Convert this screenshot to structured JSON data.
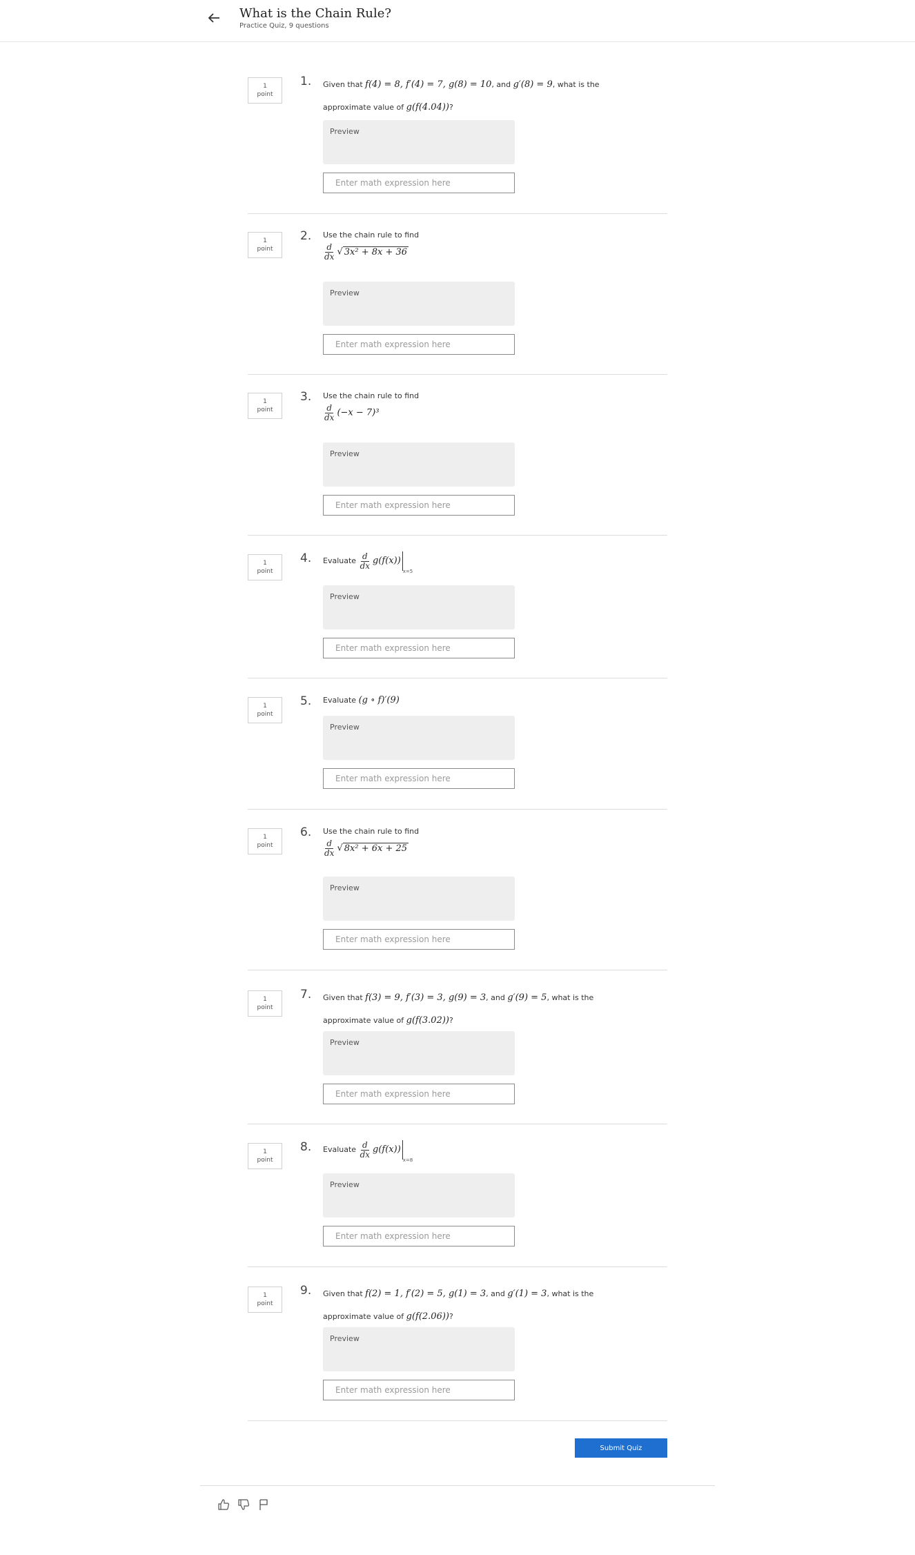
{
  "header": {
    "title": "What is the Chain Rule?",
    "subtitle": "Practice Quiz, 9 questions"
  },
  "common": {
    "points": "1",
    "points_unit": "point",
    "preview_label": "Preview",
    "input_placeholder": "Enter math expression here"
  },
  "questions": [
    {
      "number": "1.",
      "text_a": "Given that ",
      "math_a": "f(4) = 8, f′(4) = 7, g(8) = 10",
      "text_b": ", and ",
      "math_b": "g′(8) = 9",
      "text_c": ", what is the",
      "text_d": "approximate value of ",
      "math_c": "g(f(4.04))",
      "text_e": "?"
    },
    {
      "number": "2.",
      "text": "Use the chain rule to find",
      "math": "3x² + 8x + 36"
    },
    {
      "number": "3.",
      "text": "Use the chain rule to find",
      "math": "(−x − 7)³"
    },
    {
      "number": "4.",
      "text": "Evaluate",
      "math": "g(f(x))",
      "sub": "x=5"
    },
    {
      "number": "5.",
      "text": "Evaluate",
      "math": "(g ∘ f)′(9)"
    },
    {
      "number": "6.",
      "text": "Use the chain rule to find",
      "math": "8x² + 6x + 25"
    },
    {
      "number": "7.",
      "text_a": "Given that ",
      "math_a": "f(3) = 9, f′(3) = 3, g(9) = 3",
      "text_b": ", and ",
      "math_b": "g′(9) = 5",
      "text_c": ", what is the",
      "text_d": "approximate value of ",
      "math_c": "g(f(3.02))",
      "text_e": "?"
    },
    {
      "number": "8.",
      "text": "Evaluate",
      "math": "g(f(x))",
      "sub": "x=8"
    },
    {
      "number": "9.",
      "text_a": "Given that ",
      "math_a": "f(2) = 1, f′(2) = 5, g(1) = 3",
      "text_b": ", and ",
      "math_b": "g′(1) = 3",
      "text_c": ", what is the",
      "text_d": "approximate value of ",
      "math_c": "g(f(2.06))",
      "text_e": "?"
    }
  ],
  "math_symbols": {
    "d": "d",
    "dx": "dx"
  },
  "submit_label": "Submit Quiz",
  "footer_icons": [
    "thumbs-up-icon",
    "thumbs-down-icon",
    "flag-icon"
  ],
  "colors": {
    "accent": "#1f6fd0",
    "preview_bg": "#eeeeee",
    "divider": "#dcdcdc"
  }
}
